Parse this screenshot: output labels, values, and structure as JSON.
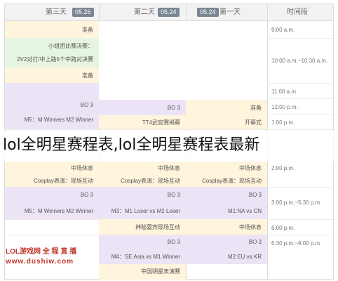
{
  "header": {
    "day3": {
      "label": "第三天",
      "date": "05.26"
    },
    "day2": {
      "label": "第二天",
      "date": "05.24"
    },
    "day1": {
      "label": "第一天",
      "date": "05.24"
    },
    "time_label": "时间段"
  },
  "times": [
    "9:00 a.m.",
    "10:00 a.m.~10:30 a.m.",
    "11:00 a.m.",
    "12:00 p.m.",
    "1:00 p.m.",
    "2:00 p.m.",
    "3:00 p.m.~5:30 p.m.",
    "6:00 p.m.",
    "6:30 p.m.~9:00 p.m."
  ],
  "day3": {
    "c1": "准备",
    "c2a": "小组团比赛决赛：",
    "c2b": "2V2对打/中上路5个中路对决赛",
    "c3": "准备",
    "c4a": "BO 3",
    "c4b": "M5：M Winners M2 Winner",
    "c5": "中场休息",
    "c6": "Cosplay表演：现场互动",
    "c7a": "BO 3",
    "c7b": "M5：M Winners M2 Winner"
  },
  "day2": {
    "c1": "BO 3",
    "c2": "TT4武官赛揭幕",
    "c3": "中场休息",
    "c4": "Cosplay表演：现场互动",
    "c5a": "BO 3",
    "c5b": "M3：M1 Loser vs M2 Loser",
    "c6": "神秘嘉宾现场互动",
    "c7a": "BO 3",
    "c7b": "M4：SE Asia vs M1 Winner",
    "c8": "中国明星表演赛"
  },
  "day1": {
    "c1": "准备",
    "c2": "开幕式",
    "c3": "中场休息",
    "c4": "Cosplay表演：现场互动",
    "c5a": "BO 3",
    "c5b": "M1:NA vs CN",
    "c6": "中场休息",
    "c7a": "BO 3",
    "c7b": "M2:EU vs KR"
  },
  "overlay_title": "lol全明星赛程表,lol全明星赛程表最新",
  "logo": {
    "line1": "LOL游戏网 全 程 直 播",
    "line2": "www.dushiw.com"
  },
  "colors": {
    "yellow": "#fff4dc",
    "green": "#e6f5e1",
    "purple": "#ece4f6",
    "header": "#f2f2f2",
    "date_badge": "#7b8694"
  }
}
